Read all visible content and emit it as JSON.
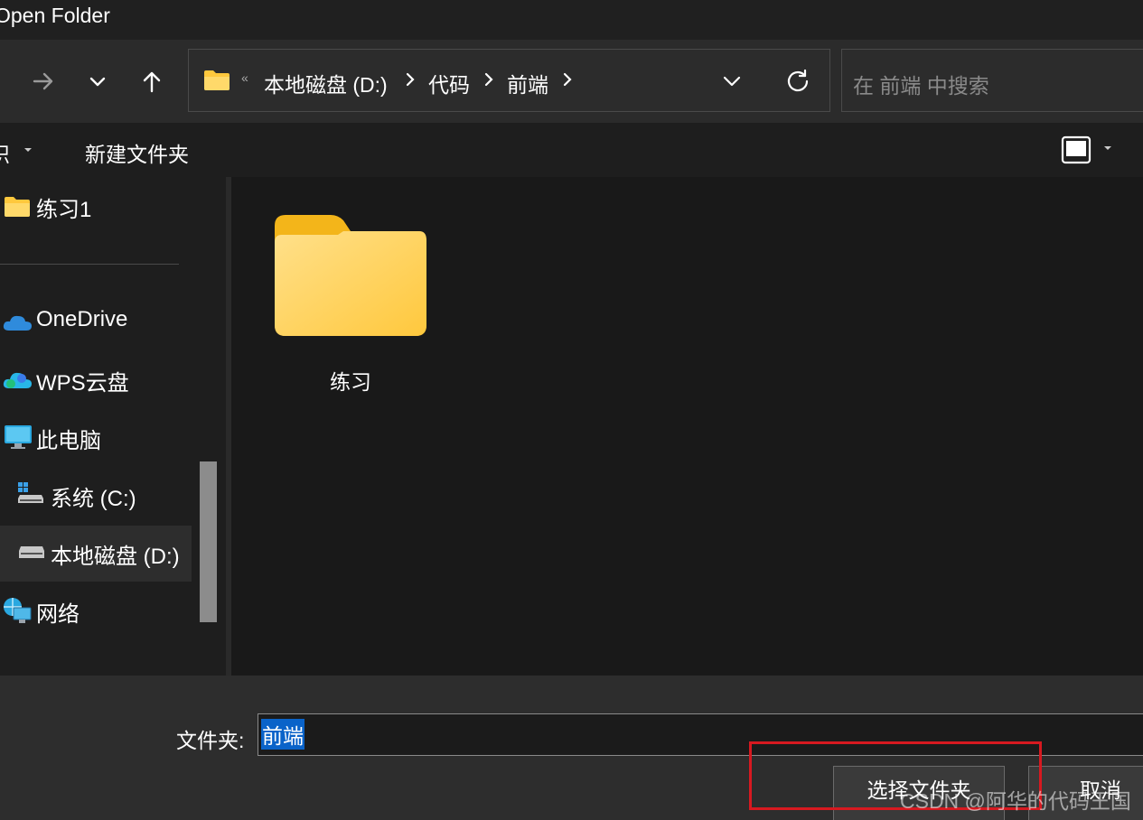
{
  "window": {
    "title": "Open Folder"
  },
  "toolbar": {
    "forward_icon": "arrow-right-icon",
    "recent_icon": "chevron-down-icon",
    "up_icon": "arrow-up-icon"
  },
  "address": {
    "crumbs": [
      "本地磁盘 (D:)",
      "代码",
      "前端"
    ],
    "overflow_marker": "«"
  },
  "search": {
    "placeholder": "在 前端 中搜索"
  },
  "command_bar": {
    "organize_label": "织",
    "new_folder_label": "新建文件夹"
  },
  "sidebar": {
    "items": [
      {
        "label": "练习1",
        "icon": "folder-icon"
      },
      {
        "label": "OneDrive",
        "icon": "cloud-icon"
      },
      {
        "label": "WPS云盘",
        "icon": "wps-cloud-icon"
      },
      {
        "label": "此电脑",
        "icon": "monitor-icon"
      },
      {
        "label": "系统 (C:)",
        "icon": "system-drive-icon"
      },
      {
        "label": "本地磁盘 (D:)",
        "icon": "drive-icon",
        "selected": true
      },
      {
        "label": "网络",
        "icon": "network-icon"
      }
    ]
  },
  "content": {
    "items": [
      {
        "label": "练习",
        "icon": "folder-icon"
      }
    ]
  },
  "footer": {
    "folder_label": "文件夹:",
    "folder_value": "前端",
    "select_button": "选择文件夹",
    "cancel_button": "取消"
  },
  "watermark": "CSDN @阿华的代码王国",
  "colors": {
    "accent_selection": "#0a63c9",
    "highlight_box": "#d71920",
    "folder_yellow": "#ffd35a"
  }
}
